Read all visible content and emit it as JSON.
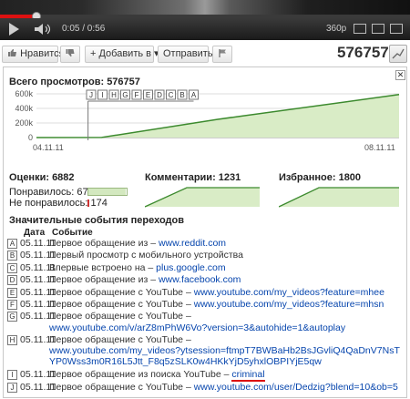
{
  "player": {
    "time": "0:05 / 0:56",
    "quality": "360p",
    "progress_fraction": 0.089
  },
  "actions": {
    "like_label": "Нравится",
    "add_label": "+ Добавить в ▾",
    "share_label": "Отправить",
    "view_count": "576757"
  },
  "stats": {
    "total_views_label": "Всего просмотров: 576757",
    "ratings_label": "Оценки: 6882",
    "likes_label": "Понравилось: 6708",
    "dislikes_label": "Не понравилось: 174",
    "likes_fraction": 0.975,
    "comments_label": "Комментарии: 1231",
    "favorites_label": "Избранное: 1800",
    "events_heading": "Значительные события переходов",
    "col_date": "Дата",
    "col_event": "Событие",
    "close_glyph": "✕"
  },
  "chart_data": {
    "type": "area",
    "x_start_label": "04.11.11",
    "x_end_label": "08.11.11",
    "y_ticks": [
      "600k",
      "400k",
      "200k",
      "0"
    ],
    "ylim": [
      0,
      600000
    ],
    "x": [
      0,
      0.18,
      0.5,
      1
    ],
    "values": [
      0,
      2000,
      250000,
      590000
    ],
    "markers": [
      "J",
      "I",
      "H",
      "G",
      "F",
      "E",
      "D",
      "C",
      "B",
      "A"
    ],
    "colors": {
      "area": "#d9ecc6",
      "line": "#3c8a2e"
    }
  },
  "events": [
    {
      "letter": "A",
      "date": "05.11.11",
      "text": "Первое обращение из – ",
      "link": "www.reddit.com"
    },
    {
      "letter": "B",
      "date": "05.11.11",
      "text": "Первый просмотр с мобильного устройства",
      "link": ""
    },
    {
      "letter": "C",
      "date": "05.11.11",
      "text": "Впервые встроено на – ",
      "link": "plus.google.com"
    },
    {
      "letter": "D",
      "date": "05.11.11",
      "text": "Первое обращение из – ",
      "link": "www.facebook.com"
    },
    {
      "letter": "E",
      "date": "05.11.11",
      "text": "Первое обращение с YouTube – ",
      "link": "www.youtube.com/my_videos?feature=mhee"
    },
    {
      "letter": "F",
      "date": "05.11.11",
      "text": "Первое обращение с YouTube – ",
      "link": "www.youtube.com/my_videos?feature=mhsn"
    },
    {
      "letter": "G",
      "date": "05.11.11",
      "text": "Первое обращение с YouTube – ",
      "link": "www.youtube.com/v/arZ8mPhW6Vo?version=3&autohide=1&autoplay"
    },
    {
      "letter": "H",
      "date": "05.11.11",
      "text": "Первое обращение с YouTube – ",
      "link": "www.youtube.com/my_videos?ytsession=ftmpT7BWBaHb2BsJGvliQ4QaDnV7NsTYP0Wss3m0R16L5Jtt_F8q5zSLK0w4HKkYjD5yhxlOBPIYjE5qw"
    },
    {
      "letter": "I",
      "date": "05.11.11",
      "text": "Первое обращение из поиска YouTube – ",
      "link": "criminal"
    },
    {
      "letter": "J",
      "date": "05.11.11",
      "text": "Первое обращение с YouTube – ",
      "link": "www.youtube.com/user/Dedzig?blend=10&ob=5"
    }
  ]
}
